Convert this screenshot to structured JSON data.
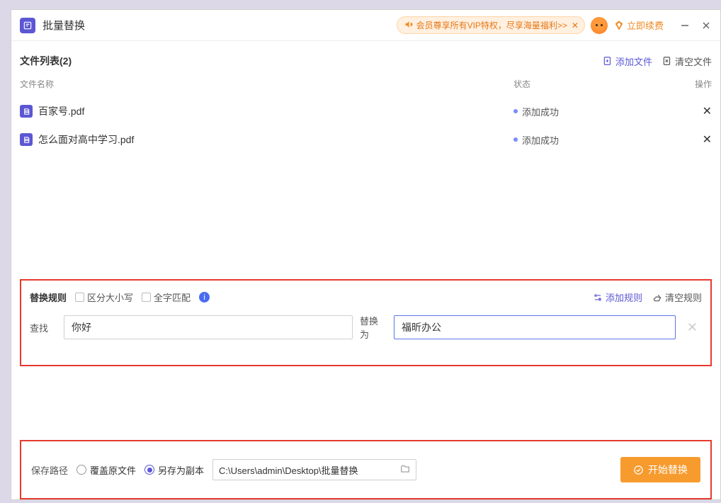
{
  "titlebar": {
    "title": "批量替换",
    "vip_text": "会员尊享所有VIP特权，尽享海量福利>>",
    "renew_label": "立即续费"
  },
  "filelist": {
    "title": "文件列表(2)",
    "add_file_label": "添加文件",
    "clear_files_label": "清空文件",
    "columns": {
      "name": "文件名称",
      "status": "状态",
      "action": "操作"
    },
    "rows": [
      {
        "name": "百家号.pdf",
        "status": "添加成功"
      },
      {
        "name": "怎么面对高中学习.pdf",
        "status": "添加成功"
      }
    ]
  },
  "rules": {
    "title": "替换规则",
    "case_sensitive_label": "区分大小写",
    "whole_word_label": "全字匹配",
    "add_rule_label": "添加规则",
    "clear_rules_label": "清空规则",
    "find_label": "查找",
    "replace_label": "替换为",
    "find_value": "你好",
    "replace_value": "福昕办公"
  },
  "save": {
    "label": "保存路径",
    "overwrite_label": "覆盖原文件",
    "saveas_label": "另存为副本",
    "path_value": "C:\\Users\\admin\\Desktop\\批量替换",
    "start_label": "开始替换"
  }
}
